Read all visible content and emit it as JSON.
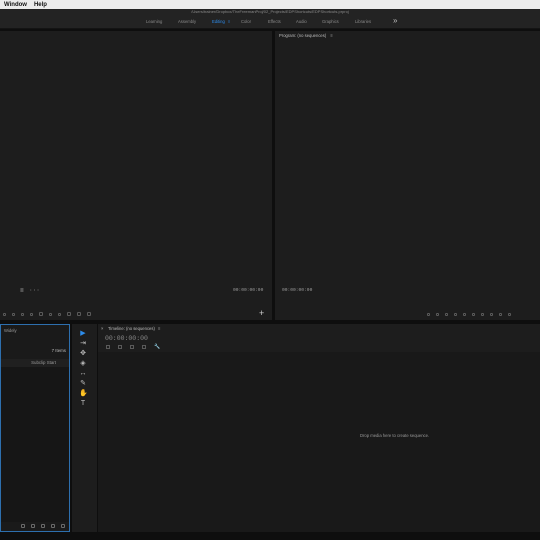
{
  "menubar": {
    "items": [
      "Window",
      "Help"
    ]
  },
  "window": {
    "path": "/Users/trainer/Dropbox/TheFreemanProj/02_Projects/EDPShortcuts/EDPShortcuts.prproj"
  },
  "workspaces": {
    "tabs": [
      "Learning",
      "Assembly",
      "Editing",
      "Color",
      "Effects",
      "Audio",
      "Graphics",
      "Libraries"
    ],
    "active": "Editing",
    "active_menu_glyph": "≡",
    "more_glyph": "»",
    "accent_color": "#2d8ceb"
  },
  "source_monitor": {
    "timecode_left": "00:00:00:00",
    "settings_glyph": "≣"
  },
  "program_monitor": {
    "title": "Program: (no sequences)",
    "menu_glyph": "≡",
    "timecode_left": "00:00:00:00",
    "add_glyph": "+"
  },
  "project_panel": {
    "header": "Widely",
    "item_count": "7 Items",
    "column_header": "Subclip Start"
  },
  "tools": {
    "items": [
      {
        "name": "selection-tool",
        "glyph": "▶"
      },
      {
        "name": "track-select-tool",
        "glyph": "⇥"
      },
      {
        "name": "ripple-edit-tool",
        "glyph": "✥"
      },
      {
        "name": "razor-tool",
        "glyph": "◈"
      },
      {
        "name": "slip-tool",
        "glyph": "↔"
      },
      {
        "name": "pen-tool",
        "glyph": "✎"
      },
      {
        "name": "hand-tool",
        "glyph": "✋"
      },
      {
        "name": "type-tool",
        "glyph": "T"
      }
    ]
  },
  "timeline": {
    "title": "Timeline: (no sequences)",
    "menu_glyph": "≡",
    "close_glyph": "×",
    "timecode": "00:00:00:00",
    "wrench_glyph": "🔧",
    "drop_hint": "Drop media here to create sequence."
  }
}
